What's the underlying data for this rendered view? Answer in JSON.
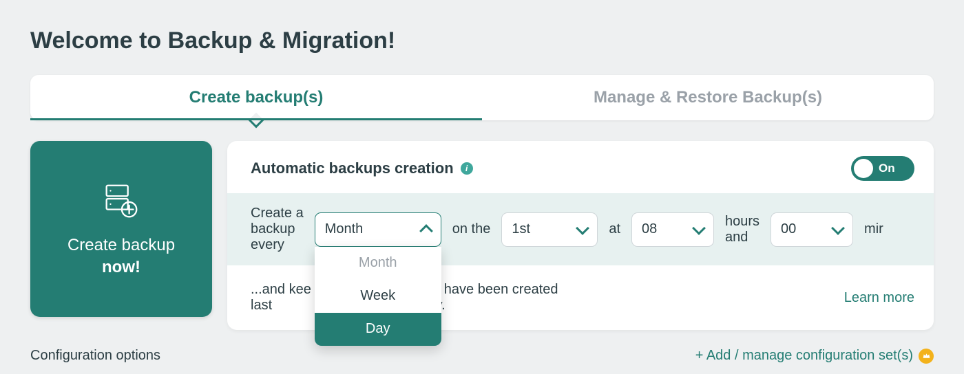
{
  "title": "Welcome to Backup & Migration!",
  "tabs": {
    "create": "Create backup(s)",
    "manage": "Manage & Restore Backup(s)"
  },
  "create_now": {
    "line1": "Create backup",
    "line2": "now!"
  },
  "auto": {
    "heading": "Automatic backups creation",
    "toggle_label": "On",
    "label_every_1": "Create a",
    "label_every_2": "backup",
    "label_every_3": "every",
    "period_value": "Month",
    "period_options": [
      "Month",
      "Week",
      "Day"
    ],
    "on_the": "on the",
    "day_value": "1st",
    "at": "at",
    "hour_value": "08",
    "hours_and_1": "hours",
    "hours_and_2": "and",
    "minute_value": "00",
    "min_suffix": "mir"
  },
  "keep": {
    "prefix1": "...and kee",
    "prefix2": "last",
    "suffix1": "backups that have been created",
    "suffix2": "automatically.",
    "learn_more": "Learn more"
  },
  "footer": {
    "config_options": "Configuration options",
    "add_config": "+ Add / manage configuration set(s)"
  }
}
